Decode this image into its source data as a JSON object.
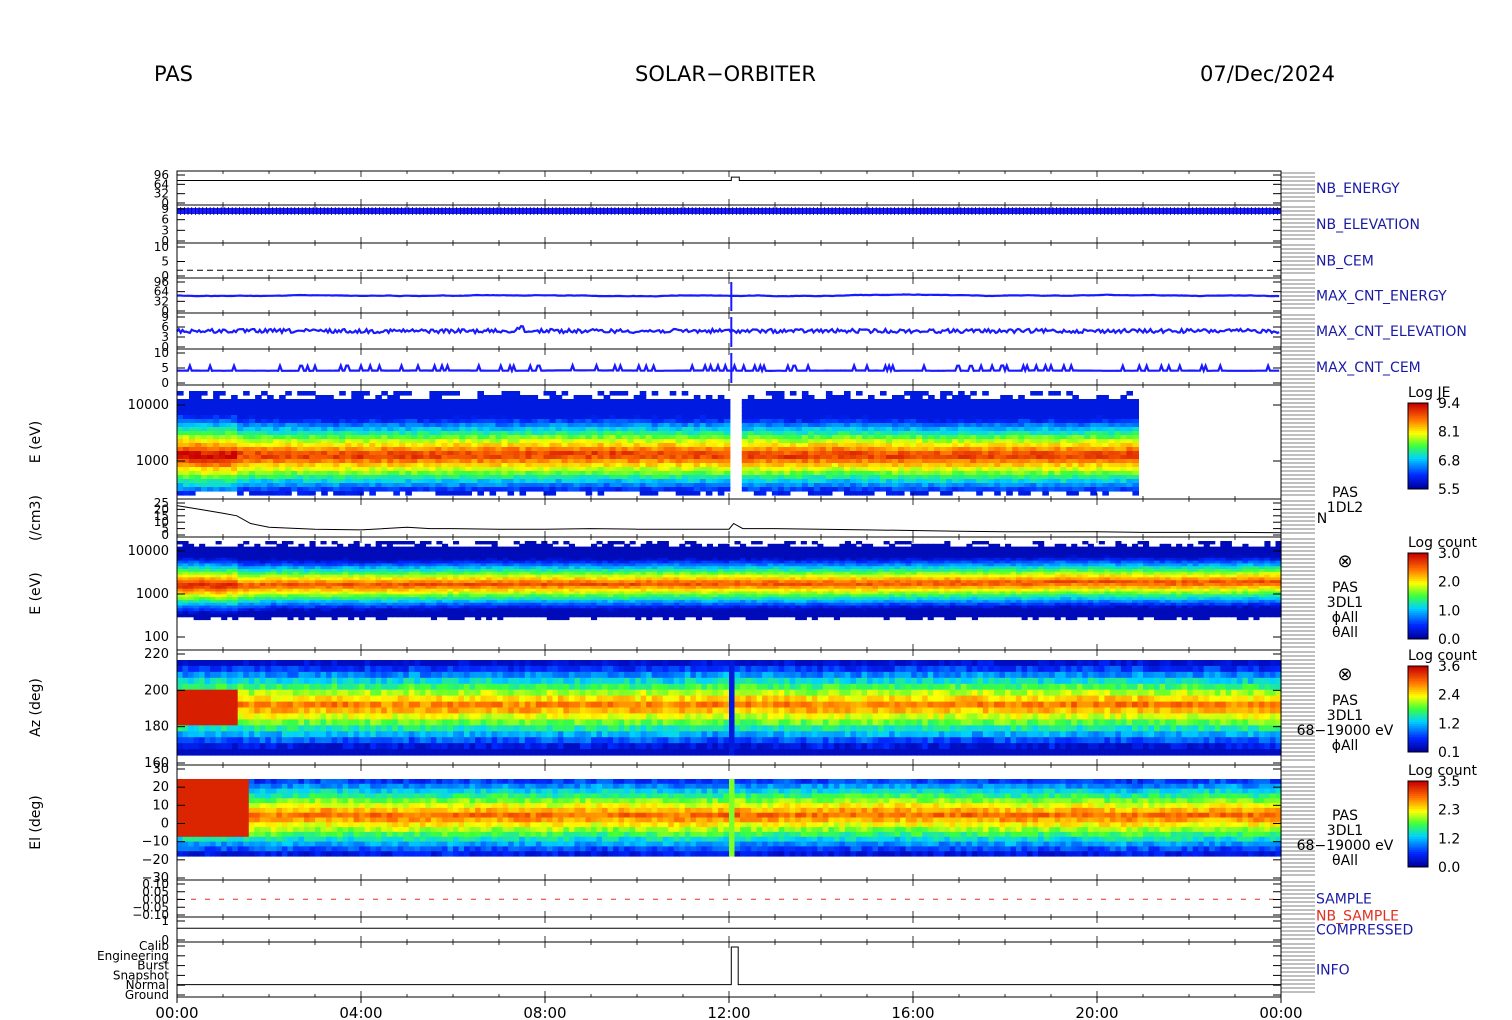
{
  "header": {
    "left": "PAS",
    "center": "SOLAR−ORBITER",
    "right": "07/Dec/2024"
  },
  "chart_data": {
    "type": "heatmap",
    "x_range": [
      "00:00",
      "24:00"
    ],
    "x_ticks": [
      "00:00",
      "04:00",
      "08:00",
      "12:00",
      "16:00",
      "20:00",
      "00:00"
    ],
    "panels": [
      {
        "id": "nb-energy",
        "right_label": "NB_ENERGY",
        "label_color": "#1a1aa6",
        "y_ticks": [
          "96",
          "64",
          "32",
          "0"
        ],
        "step_at_hours": 12.05
      },
      {
        "id": "nb-elevation",
        "right_label": "NB_ELEVATION",
        "label_color": "#1a1aa6",
        "y_ticks": [
          "9",
          "6",
          "3",
          "0"
        ]
      },
      {
        "id": "nb-cem",
        "right_label": "NB_CEM",
        "label_color": "#1a1aa6",
        "y_ticks": [
          "10",
          "5",
          "0"
        ]
      },
      {
        "id": "max-cnt-energy",
        "right_label": "MAX_CNT_ENERGY",
        "label_color": "#1a1aa6",
        "y_ticks": [
          "96",
          "64",
          "32",
          "0"
        ]
      },
      {
        "id": "max-cnt-elevation",
        "right_label": "MAX_CNT_ELEVATION",
        "label_color": "#1a1aa6",
        "y_ticks": [
          "9",
          "6",
          "3",
          "0"
        ]
      },
      {
        "id": "max-cnt-cem",
        "right_label": "MAX_CNT_CEM",
        "label_color": "#1a1aa6",
        "y_ticks": [
          "10",
          "5",
          "0"
        ]
      },
      {
        "id": "energy-flux",
        "ylabel": "E (eV)",
        "y_ticks": [
          "10000",
          "1000"
        ],
        "ylog": true,
        "data_end_hours": 20.9,
        "gap_at_hours": 12.1,
        "colorbar": {
          "title": "Log JE",
          "ticks": [
            "9.4",
            "8.1",
            "6.8",
            "5.5"
          ]
        }
      },
      {
        "id": "density",
        "ylabel": "(/cm3)",
        "y_ticks": [
          "25",
          "20",
          "15",
          "10",
          "5",
          "0"
        ],
        "right_text": [
          "PAS",
          "1DL2"
        ],
        "right_label_n": "N",
        "density_points": [
          [
            0,
            23
          ],
          [
            0.5,
            20
          ],
          [
            1,
            17
          ],
          [
            1.3,
            15
          ],
          [
            1.6,
            9
          ],
          [
            2,
            6
          ],
          [
            3,
            4.5
          ],
          [
            4,
            4
          ],
          [
            5,
            6
          ],
          [
            5.5,
            5
          ],
          [
            6,
            5
          ],
          [
            7,
            4.5
          ],
          [
            8,
            4.5
          ],
          [
            9,
            5
          ],
          [
            10,
            4.5
          ],
          [
            11,
            4.5
          ],
          [
            12,
            4.5
          ],
          [
            12.1,
            9
          ],
          [
            12.3,
            5
          ],
          [
            13,
            5
          ],
          [
            14,
            4.5
          ],
          [
            15,
            4
          ],
          [
            16,
            3.5
          ],
          [
            17,
            3
          ],
          [
            18,
            2.5
          ],
          [
            19,
            2.5
          ],
          [
            20,
            2.5
          ],
          [
            21,
            2
          ],
          [
            22,
            2
          ],
          [
            23,
            2
          ],
          [
            24,
            1.8
          ]
        ]
      },
      {
        "id": "energy-count",
        "ylabel": "E (eV)",
        "y_ticks": [
          "10000",
          "1000",
          "100"
        ],
        "ylog": true,
        "right_text": [
          "PAS",
          "3DL1",
          "ϕAll",
          "θAll"
        ],
        "symbol": "⊗",
        "colorbar": {
          "title": "Log count",
          "ticks": [
            "3.0",
            "2.0",
            "1.0",
            "0.0"
          ]
        }
      },
      {
        "id": "azimuth",
        "ylabel": "Az (deg)",
        "y_ticks": [
          "220",
          "200",
          "180",
          "160"
        ],
        "right_text": [
          "PAS",
          "3DL1",
          "68−19000 eV",
          "ϕAll"
        ],
        "symbol": "⊗",
        "colorbar": {
          "title": "Log count",
          "ticks": [
            "3.6",
            "2.4",
            "1.2",
            "0.1"
          ]
        }
      },
      {
        "id": "elevation",
        "ylabel": "El (deg)",
        "y_ticks": [
          "30",
          "20",
          "10",
          "0",
          "−10",
          "−20",
          "−30"
        ],
        "right_text": [
          "PAS",
          "3DL1",
          "68−19000 eV",
          "θAll"
        ],
        "colorbar": {
          "title": "Log count",
          "ticks": [
            "3.5",
            "2.3",
            "1.2",
            "0.0"
          ]
        }
      },
      {
        "id": "sample",
        "right_label": "SAMPLE",
        "label_color": "#1a1aa6",
        "right_label2": "NB_SAMPLE",
        "label2_color": "#e03020",
        "y_ticks": [
          "0.10",
          "0.05",
          "0.00",
          "−0.05",
          "−0.10"
        ]
      },
      {
        "id": "compressed",
        "right_label": "COMPRESSED",
        "label_color": "#1a1aa6",
        "y_ticks": [
          "1",
          "0"
        ]
      },
      {
        "id": "info",
        "right_label": "INFO",
        "label_color": "#1a1aa6",
        "y_ticks": [
          "Calib",
          "Engineering",
          "Burst",
          "Snapshot",
          "Normal",
          "Ground"
        ],
        "step_at_hours": 12.05,
        "step_end_hours": 12.2
      }
    ]
  }
}
